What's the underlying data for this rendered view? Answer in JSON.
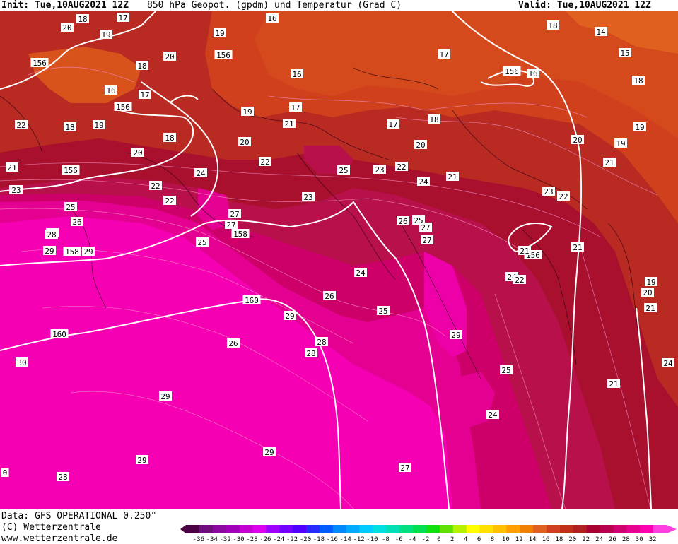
{
  "header": {
    "init": "Init: Tue,10AUG2021 12Z",
    "title": "850 hPa Geopot. (gpdm) und Temperatur (Grad C)",
    "valid": "Valid: Tue,10AUG2021 12Z"
  },
  "footer": {
    "data_source": "Data: GFS OPERATIONAL 0.250°",
    "copyright": "(C) Wetterzentrale",
    "url": "www.wetterzentrale.de"
  },
  "legend": {
    "ticks": [
      "-36",
      "-34",
      "-32",
      "-30",
      "-28",
      "-26",
      "-24",
      "-22",
      "-20",
      "-18",
      "-16",
      "-14",
      "-12",
      "-10",
      "-8",
      "-6",
      "-4",
      "-2",
      "0",
      "2",
      "4",
      "6",
      "8",
      "10",
      "12",
      "14",
      "16",
      "18",
      "20",
      "22",
      "24",
      "26",
      "28",
      "30",
      "32"
    ],
    "colors": [
      "#4b0044",
      "#6f0f7a",
      "#8a0aa0",
      "#a000b8",
      "#c400d0",
      "#dd00ee",
      "#9b00ff",
      "#7400ff",
      "#5000ff",
      "#2828ff",
      "#005cff",
      "#0088ff",
      "#00aaff",
      "#00ccff",
      "#00e0e0",
      "#00e0b4",
      "#00e080",
      "#00e050",
      "#10e010",
      "#60e000",
      "#b4f000",
      "#ffff00",
      "#ffe000",
      "#ffc000",
      "#ffa000",
      "#f08000",
      "#e06020",
      "#d04020",
      "#c03018",
      "#b02020",
      "#a80030",
      "#b80050",
      "#d00070",
      "#e80090",
      "#ff00b0",
      "#ff40e0"
    ]
  },
  "geopotential_labels": [
    {
      "text": "156"
    },
    {
      "text": "156"
    },
    {
      "text": "156"
    },
    {
      "text": "156"
    },
    {
      "text": "156"
    },
    {
      "text": "156"
    },
    {
      "text": "158"
    },
    {
      "text": "158"
    },
    {
      "text": "160"
    },
    {
      "text": "160"
    }
  ],
  "temperature_labels": [
    {
      "text": "20"
    },
    {
      "text": "18"
    },
    {
      "text": "19"
    },
    {
      "text": "17"
    },
    {
      "text": "19"
    },
    {
      "text": "16"
    },
    {
      "text": "18"
    },
    {
      "text": "14"
    },
    {
      "text": "15"
    },
    {
      "text": "17"
    },
    {
      "text": "16"
    },
    {
      "text": "18"
    },
    {
      "text": "20"
    },
    {
      "text": "18"
    },
    {
      "text": "16"
    },
    {
      "text": "17"
    },
    {
      "text": "18"
    },
    {
      "text": "20"
    },
    {
      "text": "16"
    },
    {
      "text": "17"
    },
    {
      "text": "19"
    },
    {
      "text": "18"
    },
    {
      "text": "22"
    },
    {
      "text": "19"
    },
    {
      "text": "21"
    },
    {
      "text": "20"
    },
    {
      "text": "17"
    },
    {
      "text": "19"
    },
    {
      "text": "20"
    },
    {
      "text": "22"
    },
    {
      "text": "21"
    },
    {
      "text": "24"
    },
    {
      "text": "23"
    },
    {
      "text": "22"
    },
    {
      "text": "23"
    },
    {
      "text": "25"
    },
    {
      "text": "23"
    },
    {
      "text": "22"
    },
    {
      "text": "24"
    },
    {
      "text": "21"
    },
    {
      "text": "20"
    },
    {
      "text": "19"
    },
    {
      "text": "21"
    },
    {
      "text": "18"
    },
    {
      "text": "25"
    },
    {
      "text": "27"
    },
    {
      "text": "26"
    },
    {
      "text": "28"
    },
    {
      "text": "29"
    },
    {
      "text": "25"
    },
    {
      "text": "27"
    },
    {
      "text": "26"
    },
    {
      "text": "25"
    },
    {
      "text": "27"
    },
    {
      "text": "28"
    },
    {
      "text": "21"
    },
    {
      "text": "23"
    },
    {
      "text": "22"
    },
    {
      "text": "21"
    },
    {
      "text": "24"
    },
    {
      "text": "22"
    },
    {
      "text": "19"
    },
    {
      "text": "20"
    },
    {
      "text": "21"
    },
    {
      "text": "26"
    },
    {
      "text": "24"
    },
    {
      "text": "29"
    },
    {
      "text": "26"
    },
    {
      "text": "25"
    },
    {
      "text": "28"
    },
    {
      "text": "29"
    },
    {
      "text": "28"
    },
    {
      "text": "22"
    },
    {
      "text": "24"
    },
    {
      "text": "30"
    },
    {
      "text": "25"
    },
    {
      "text": "21"
    },
    {
      "text": "29"
    },
    {
      "text": "24"
    },
    {
      "text": "29"
    },
    {
      "text": "29"
    },
    {
      "text": "27"
    },
    {
      "text": "28"
    },
    {
      "text": "0"
    },
    {
      "text": "27"
    },
    {
      "text": "29"
    },
    {
      "text": "23"
    }
  ]
}
